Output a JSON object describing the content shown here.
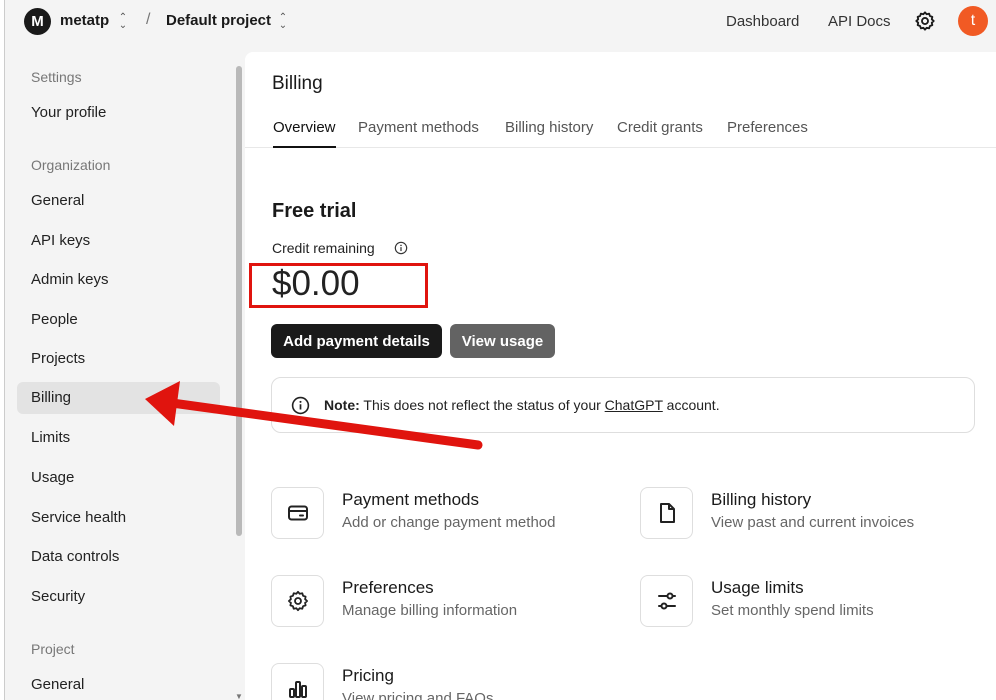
{
  "topbar": {
    "org_initial": "M",
    "org_name": "metatp",
    "separator": "/",
    "project_name": "Default project",
    "links": [
      "Dashboard",
      "API Docs"
    ],
    "user_initial": "t"
  },
  "sidebar": {
    "settings_heading": "Settings",
    "your_profile": "Your profile",
    "organization_heading": "Organization",
    "org_items": [
      "General",
      "API keys",
      "Admin keys",
      "People",
      "Projects",
      "Billing",
      "Limits",
      "Usage",
      "Service health",
      "Data controls",
      "Security"
    ],
    "project_heading": "Project",
    "project_items": [
      "General"
    ],
    "active_item": "Billing"
  },
  "main": {
    "title": "Billing",
    "tabs": [
      "Overview",
      "Payment methods",
      "Billing history",
      "Credit grants",
      "Preferences"
    ],
    "active_tab": "Overview",
    "section_title": "Free trial",
    "credit_label": "Credit remaining",
    "credit_amount": "$0.00",
    "add_payment_button": "Add payment details",
    "view_usage_button": "View usage",
    "note": {
      "prefix": "Note:",
      "text_before": " This does not reflect the status of your ",
      "link": "ChatGPT",
      "text_after": " account."
    },
    "cards": [
      {
        "title": "Payment methods",
        "subtitle": "Add or change payment method",
        "icon": "credit-card-icon"
      },
      {
        "title": "Billing history",
        "subtitle": "View past and current invoices",
        "icon": "document-icon"
      },
      {
        "title": "Preferences",
        "subtitle": "Manage billing information",
        "icon": "gear-icon"
      },
      {
        "title": "Usage limits",
        "subtitle": "Set monthly spend limits",
        "icon": "sliders-icon"
      },
      {
        "title": "Pricing",
        "subtitle": "View pricing and FAQs",
        "icon": "bar-chart-icon"
      }
    ]
  },
  "colors": {
    "annotation_red": "#e0140e",
    "user_avatar": "#f15a24",
    "button_dark": "#1a1a1a",
    "button_gray": "#636363"
  }
}
